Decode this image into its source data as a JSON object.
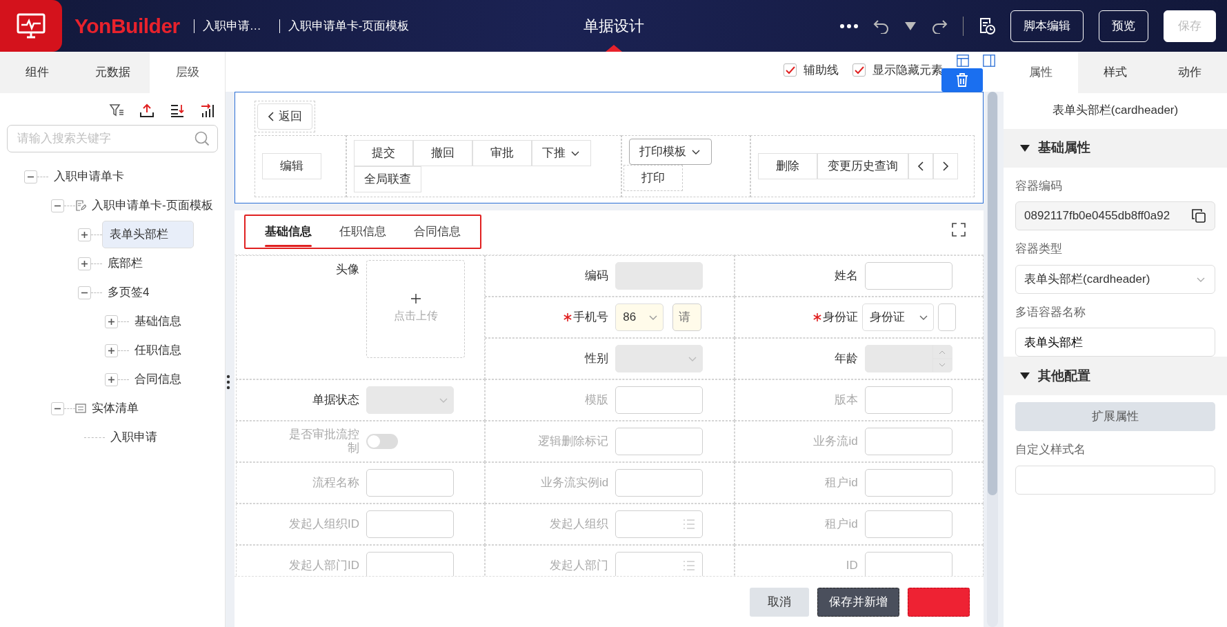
{
  "topbar": {
    "brand": "YonBuilder",
    "breadcrumbs": [
      "入职申请…",
      "入职申请单卡-页面模板"
    ],
    "title": "单据设计",
    "buttons": [
      {
        "label": "脚本编辑",
        "disabled": false
      },
      {
        "label": "预览",
        "disabled": false
      },
      {
        "label": "保存",
        "disabled": true
      }
    ]
  },
  "left_panel": {
    "tabs": [
      {
        "label": "组件",
        "selected": false
      },
      {
        "label": "元数据",
        "selected": false
      },
      {
        "label": "层级",
        "selected": true
      }
    ],
    "search": {
      "placeholder": "请输入搜索关键字"
    },
    "tree": [
      {
        "label": "入职申请单卡",
        "kind": "node",
        "expanded": true,
        "selected": false,
        "children": [
          {
            "label": "入职申请单卡-页面模板",
            "kind": "template",
            "expanded": true,
            "selected": false,
            "children": [
              {
                "label": "表单头部栏",
                "kind": "node",
                "expanded": false,
                "selected": true
              },
              {
                "label": "底部栏",
                "kind": "node",
                "expanded": false,
                "selected": false
              },
              {
                "label": "多页签4",
                "kind": "node",
                "expanded": true,
                "selected": false,
                "children": [
                  {
                    "label": "基础信息",
                    "kind": "node",
                    "expanded": false,
                    "selected": false
                  },
                  {
                    "label": "任职信息",
                    "kind": "node",
                    "expanded": false,
                    "selected": false
                  },
                  {
                    "label": "合同信息",
                    "kind": "node",
                    "expanded": false,
                    "selected": false
                  }
                ]
              }
            ]
          },
          {
            "label": "实体清单",
            "kind": "entity",
            "expanded": true,
            "selected": false,
            "children": [
              {
                "label": "入职申请",
                "kind": "leaf",
                "selected": false
              }
            ]
          }
        ]
      }
    ]
  },
  "canvas": {
    "options": [
      {
        "label": "辅助线",
        "checked": true
      },
      {
        "label": "显示隐藏元素",
        "checked": true
      }
    ],
    "header": {
      "back": "返回",
      "groups": [
        [
          {
            "kind": "button",
            "label": "编辑"
          }
        ],
        [
          {
            "kind": "button",
            "label": "提交"
          },
          {
            "kind": "button",
            "label": "撤回"
          },
          {
            "kind": "button",
            "label": "审批"
          },
          {
            "kind": "dropdown",
            "label": "下推"
          },
          {
            "kind": "button",
            "label": "全局联查"
          }
        ],
        [
          {
            "kind": "dropdown",
            "label": "打印模板"
          },
          {
            "kind": "button",
            "label": "打印"
          }
        ],
        [
          {
            "kind": "button",
            "label": "删除"
          },
          {
            "kind": "button",
            "label": "变更历史查询"
          },
          {
            "kind": "prev"
          },
          {
            "kind": "next"
          }
        ]
      ]
    },
    "form_tabs": [
      {
        "label": "基础信息",
        "selected": true
      },
      {
        "label": "任职信息",
        "selected": false
      },
      {
        "label": "合同信息",
        "selected": false
      }
    ],
    "fields": [
      {
        "kind": "upload",
        "label": "头像",
        "text": "点击上传",
        "required": false,
        "hidden": false
      },
      {
        "kind": "text",
        "label": "编码",
        "required": false,
        "hidden": false,
        "readonly": true
      },
      {
        "kind": "text",
        "label": "姓名",
        "required": false,
        "hidden": false,
        "readonly": false
      },
      {
        "kind": "phone",
        "label": "手机号",
        "value": "86",
        "placeholder": "请",
        "required": true,
        "hidden": false
      },
      {
        "kind": "idcard",
        "label": "身份证",
        "value": "身份证",
        "required": true,
        "hidden": false
      },
      {
        "kind": "select",
        "label": "性别",
        "required": false,
        "hidden": false,
        "readonly": true
      },
      {
        "kind": "number",
        "label": "年龄",
        "required": false,
        "hidden": false,
        "readonly": true
      },
      {
        "kind": "select",
        "label": "单据状态",
        "required": false,
        "hidden": false,
        "readonly": true
      },
      {
        "kind": "text",
        "label": "模版",
        "required": false,
        "hidden": true,
        "readonly": false
      },
      {
        "kind": "text",
        "label": "版本",
        "required": false,
        "hidden": true,
        "readonly": false
      },
      {
        "kind": "switch",
        "label": "是否审批流控制",
        "on": false,
        "required": false,
        "hidden": true
      },
      {
        "kind": "text",
        "label": "逻辑删除标记",
        "required": false,
        "hidden": true,
        "readonly": false
      },
      {
        "kind": "text",
        "label": "业务流id",
        "required": false,
        "hidden": true,
        "readonly": false
      },
      {
        "kind": "text",
        "label": "流程名称",
        "required": false,
        "hidden": true,
        "readonly": false
      },
      {
        "kind": "text",
        "label": "业务流实例id",
        "required": false,
        "hidden": true,
        "readonly": false
      },
      {
        "kind": "text",
        "label": "租户id",
        "required": false,
        "hidden": true,
        "readonly": false
      },
      {
        "kind": "text",
        "label": "发起人组织ID",
        "required": false,
        "hidden": true,
        "readonly": false
      },
      {
        "kind": "picker",
        "label": "发起人组织",
        "required": false,
        "hidden": true
      },
      {
        "kind": "text",
        "label": "租户id",
        "required": false,
        "hidden": true,
        "readonly": false
      },
      {
        "kind": "text",
        "label": "发起人部门ID",
        "required": false,
        "hidden": true,
        "readonly": false
      },
      {
        "kind": "picker",
        "label": "发起人部门",
        "required": false,
        "hidden": true
      },
      {
        "kind": "text",
        "label": "ID",
        "required": false,
        "hidden": true,
        "readonly": false
      }
    ],
    "footer": [
      {
        "kind": "cancel",
        "label": "取消"
      },
      {
        "kind": "save",
        "label": "保存并新增"
      },
      {
        "kind": "primary"
      }
    ]
  },
  "right_panel": {
    "tabs": [
      {
        "label": "属性",
        "selected": true
      },
      {
        "label": "样式",
        "selected": false
      },
      {
        "label": "动作",
        "selected": false
      }
    ],
    "title": "表单头部栏(cardheader)",
    "sections": [
      {
        "title": "基础属性",
        "expanded": true,
        "items": [
          {
            "kind": "copy-input",
            "label": "容器编码",
            "value": "0892117fb0e0455db8ff0a92"
          },
          {
            "kind": "select",
            "label": "容器类型",
            "value": "表单头部栏(cardheader)"
          },
          {
            "kind": "input",
            "label": "多语容器名称",
            "value": "表单头部栏"
          }
        ]
      },
      {
        "title": "其他配置",
        "expanded": true,
        "items": [
          {
            "kind": "button",
            "label": "扩展属性"
          },
          {
            "kind": "input",
            "label": "自定义样式名"
          }
        ]
      }
    ]
  }
}
